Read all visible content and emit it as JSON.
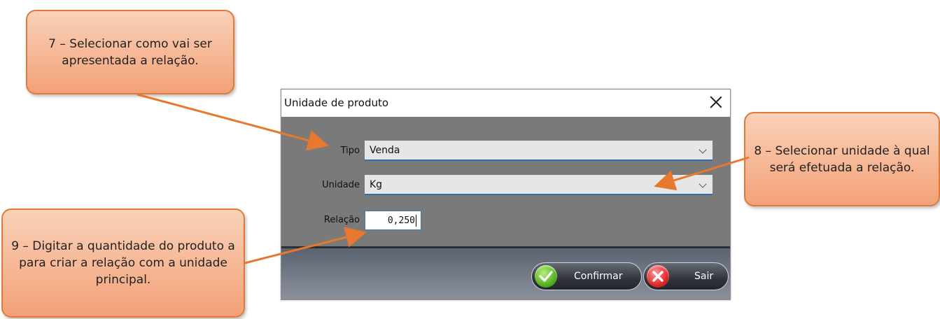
{
  "dialog": {
    "title": "Unidade de produto",
    "fields": {
      "tipo": {
        "label": "Tipo",
        "value": "Venda"
      },
      "unidade": {
        "label": "Unidade",
        "value": "Kg"
      },
      "relacao": {
        "label": "Relação",
        "value": "0,250"
      }
    },
    "buttons": {
      "confirm": "Confirmar",
      "exit": "Sair"
    }
  },
  "callouts": {
    "step7": "7 – Selecionar como vai ser apresentada a relação.",
    "step8": "8 – Selecionar unidade à qual será efetuada a relação.",
    "step9": "9 – Digitar a quantidade do produto a para criar a relação com a unidade principal."
  },
  "colors": {
    "callout_fill": "#f2a178",
    "callout_border": "#e07a38",
    "arrow": "#e8782f",
    "dialog_body": "#7a7a7a",
    "input_focus": "#2f6fb0"
  },
  "icons": {
    "confirm": "check-icon",
    "exit": "close-icon"
  }
}
